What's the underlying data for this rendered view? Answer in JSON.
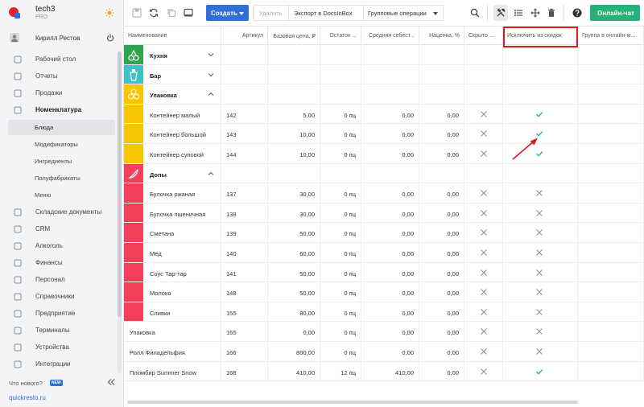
{
  "brand": {
    "name": "tech3",
    "plan": "PRO"
  },
  "user": {
    "name": "Кирилл Рестов"
  },
  "sidebar": {
    "items": [
      {
        "label": "Рабочий стол",
        "icon": "desktop-icon"
      },
      {
        "label": "Отчеты",
        "icon": "chart-icon"
      },
      {
        "label": "Продажи",
        "icon": "cart-icon"
      },
      {
        "label": "Номенклатура",
        "icon": "tag-icon"
      }
    ],
    "subitems": [
      {
        "label": "Блюда",
        "active": true
      },
      {
        "label": "Модификаторы"
      },
      {
        "label": "Ингредиенты"
      },
      {
        "label": "Полуфабрикаты"
      },
      {
        "label": "Меню"
      }
    ],
    "items2": [
      {
        "label": "Складские документы",
        "icon": "warehouse-icon"
      },
      {
        "label": "CRM",
        "icon": "crm-icon"
      },
      {
        "label": "Алкоголь",
        "icon": "bottle-icon"
      },
      {
        "label": "Финансы",
        "icon": "wallet-icon"
      },
      {
        "label": "Персонал",
        "icon": "people-icon"
      },
      {
        "label": "Справочники",
        "icon": "book-icon"
      },
      {
        "label": "Предприятие",
        "icon": "building-icon"
      },
      {
        "label": "Терминалы",
        "icon": "terminal-icon"
      },
      {
        "label": "Устройства",
        "icon": "printer-icon"
      },
      {
        "label": "Интеграции",
        "icon": "link-icon"
      }
    ],
    "whats_new": "Что нового?",
    "new_badge": "NEW",
    "site": "quickresto.ru"
  },
  "toolbar": {
    "create_label": "Создать",
    "delete_label": "Удалить",
    "export_label": "Экспорт в DocsInBox",
    "group_ops_label": "Групповые операции",
    "chat_label": "Онлайн-чат"
  },
  "table": {
    "columns": [
      "Наименование",
      "Артикул",
      "Базовая цена, ₽",
      "Остаток ...",
      "Средняя себест...",
      "Наценка, %",
      "Скрыто ...",
      "Исключить из скидок",
      "Группа в онлайн-м..."
    ],
    "rows": [
      {
        "type": "group",
        "name": "Кухня",
        "color": "#2ea44f",
        "icon": "cherries-icon",
        "expanded": false
      },
      {
        "type": "group",
        "name": "Бар",
        "color": "#3fc1c9",
        "icon": "drink-icon",
        "expanded": false
      },
      {
        "type": "group",
        "name": "Упаковка",
        "color": "#f7c600",
        "icon": "circles-icon",
        "expanded": true
      },
      {
        "type": "item",
        "group_color": "#f7c600",
        "name": "Контейнер малый",
        "sku": "142",
        "price": "5,00",
        "stock": "0 пц",
        "cost": "0,00",
        "markup": "0,00",
        "hidden": "x",
        "exclude": "check"
      },
      {
        "type": "item",
        "group_color": "#f7c600",
        "name": "Контейнер большой",
        "sku": "143",
        "price": "10,00",
        "stock": "0 пц",
        "cost": "0,00",
        "markup": "0,00",
        "hidden": "x",
        "exclude": "check"
      },
      {
        "type": "item",
        "group_color": "#f7c600",
        "name": "Контейнер суповой",
        "sku": "144",
        "price": "10,00",
        "stock": "0 пц",
        "cost": "0,00",
        "markup": "0,00",
        "hidden": "x",
        "exclude": "check"
      },
      {
        "type": "group",
        "name": "Допы",
        "color": "#f2405a",
        "icon": "pepper-icon",
        "expanded": true
      },
      {
        "type": "item",
        "group_color": "#f2405a",
        "name": "Булочка ржаная",
        "sku": "137",
        "price": "30,00",
        "stock": "0 пц",
        "cost": "0,00",
        "markup": "0,00",
        "hidden": "x",
        "exclude": "x"
      },
      {
        "type": "item",
        "group_color": "#f2405a",
        "name": "Булочка пшеничная",
        "sku": "138",
        "price": "30,00",
        "stock": "0 пц",
        "cost": "0,00",
        "markup": "0,00",
        "hidden": "x",
        "exclude": "x"
      },
      {
        "type": "item",
        "group_color": "#f2405a",
        "name": "Сметана",
        "sku": "139",
        "price": "50,00",
        "stock": "0 пц",
        "cost": "0,00",
        "markup": "0,00",
        "hidden": "x",
        "exclude": "x"
      },
      {
        "type": "item",
        "group_color": "#f2405a",
        "name": "Мед",
        "sku": "140",
        "price": "60,00",
        "stock": "0 пц",
        "cost": "0,00",
        "markup": "0,00",
        "hidden": "x",
        "exclude": "x"
      },
      {
        "type": "item",
        "group_color": "#f2405a",
        "name": "Соус Тар-тар",
        "sku": "141",
        "price": "50,00",
        "stock": "0 пц",
        "cost": "0,00",
        "markup": "0,00",
        "hidden": "x",
        "exclude": "x"
      },
      {
        "type": "item",
        "group_color": "#f2405a",
        "name": "Молоко",
        "sku": "148",
        "price": "50,00",
        "stock": "0 пц",
        "cost": "0,00",
        "markup": "0,00",
        "hidden": "x",
        "exclude": "x"
      },
      {
        "type": "item",
        "group_color": "#f2405a",
        "name": "Сливки",
        "sku": "155",
        "price": "80,00",
        "stock": "0 пц",
        "cost": "0,00",
        "markup": "0,00",
        "hidden": "x",
        "exclude": "x"
      },
      {
        "type": "plain",
        "name": "Упаковка",
        "sku": "165",
        "price": "0,00",
        "stock": "0 пц",
        "cost": "0,00",
        "markup": "0,00",
        "hidden": "x",
        "exclude": "x"
      },
      {
        "type": "plain",
        "name": "Ролл Филадельфия",
        "sku": "166",
        "price": "800,00",
        "stock": "0 пц",
        "cost": "0,00",
        "markup": "0,00",
        "hidden": "x",
        "exclude": "x"
      },
      {
        "type": "plain",
        "name": "Пломбир Summer Snow",
        "sku": "168",
        "price": "410,00",
        "stock": "12 пц",
        "cost": "410,00",
        "markup": "0,00",
        "hidden": "x",
        "exclude": "check"
      }
    ]
  },
  "colors": {
    "accent": "#2f6fd6",
    "chat": "#26b07a",
    "check": "#26b07a",
    "x": "#8a9099",
    "highlight": "#e01919"
  }
}
